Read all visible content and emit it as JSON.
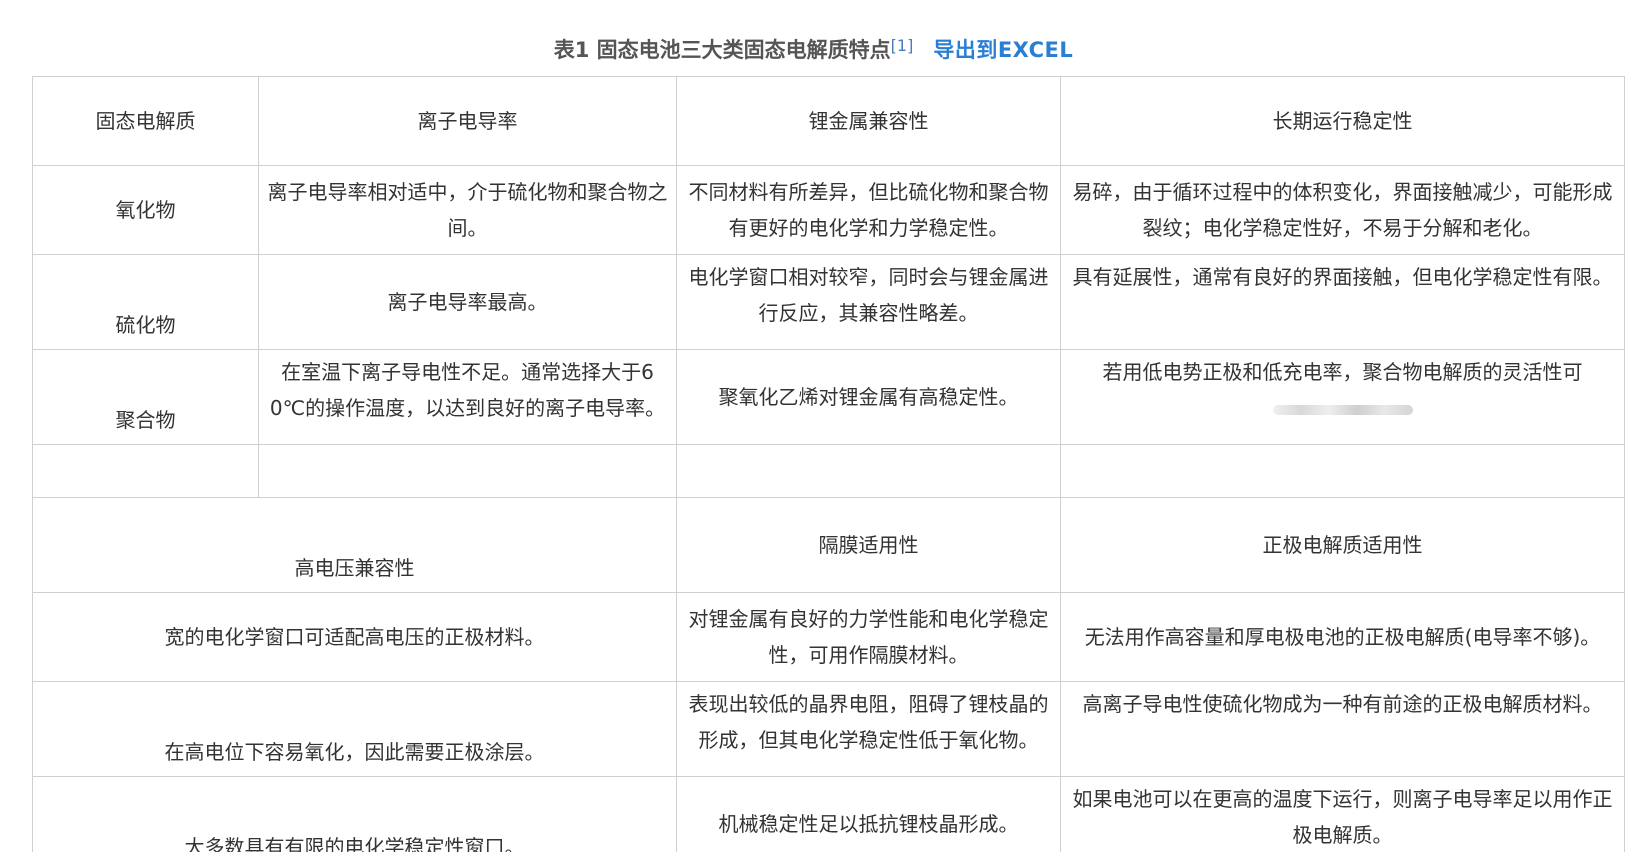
{
  "caption": {
    "title": "表1 固态电池三大类固态电解质特点",
    "ref": "[1]",
    "export_label": "导出到EXCEL"
  },
  "table": {
    "header1": {
      "corner": "固态电解质",
      "col1": "离子电导率",
      "col2": "锂金属兼容性",
      "col3": "长期运行稳定性"
    },
    "rows1": [
      {
        "label": "氧化物",
        "c1": "离子电导率相对适中，介于硫化物和聚合物之间。",
        "c2": "不同材料有所差异，但比硫化物和聚合物有更好的电化学和力学稳定性。",
        "c3": "易碎，由于循环过程中的体积变化，界面接触减少，可能形成裂纹；电化学稳定性好，不易于分解和老化。"
      },
      {
        "label": "硫化物",
        "c1": "离子电导率最高。",
        "c2": "电化学窗口相对较窄，同时会与锂金属进行反应，其兼容性略差。",
        "c3": "具有延展性，通常有良好的界面接触，但电化学稳定性有限。"
      },
      {
        "label": "聚合物",
        "c1": "在室温下离子导电性不足。通常选择大于60℃的操作温度，以达到良好的离子电导率。",
        "c2": "聚氧化乙烯对锂金属有高稳定性。",
        "c3": "若用低电势正极和低充电率，聚合物电解质的灵活性可"
      }
    ],
    "header2": {
      "col1": "高电压兼容性",
      "col2": "隔膜适用性",
      "col3": "正极电解质适用性"
    },
    "rows2": [
      {
        "c1": "宽的电化学窗口可适配高电压的正极材料。",
        "c2": "对锂金属有良好的力学性能和电化学稳定性，可用作隔膜材料。",
        "c3": "无法用作高容量和厚电极电池的正极电解质(电导率不够)。"
      },
      {
        "c1": "在高电位下容易氧化，因此需要正极涂层。",
        "c2": "表现出较低的晶界电阻，阻碍了锂枝晶的形成，但其电化学稳定性低于氧化物。",
        "c3": "高离子导电性使硫化物成为一种有前途的正极电解质材料。"
      },
      {
        "c1": "大多数具有有限的电化学稳定性窗口。",
        "c2": "机械稳定性足以抵抗锂枝晶形成。",
        "c3": "如果电池可以在更高的温度下运行，则离子电导率足以用作正极电解质。"
      }
    ]
  }
}
